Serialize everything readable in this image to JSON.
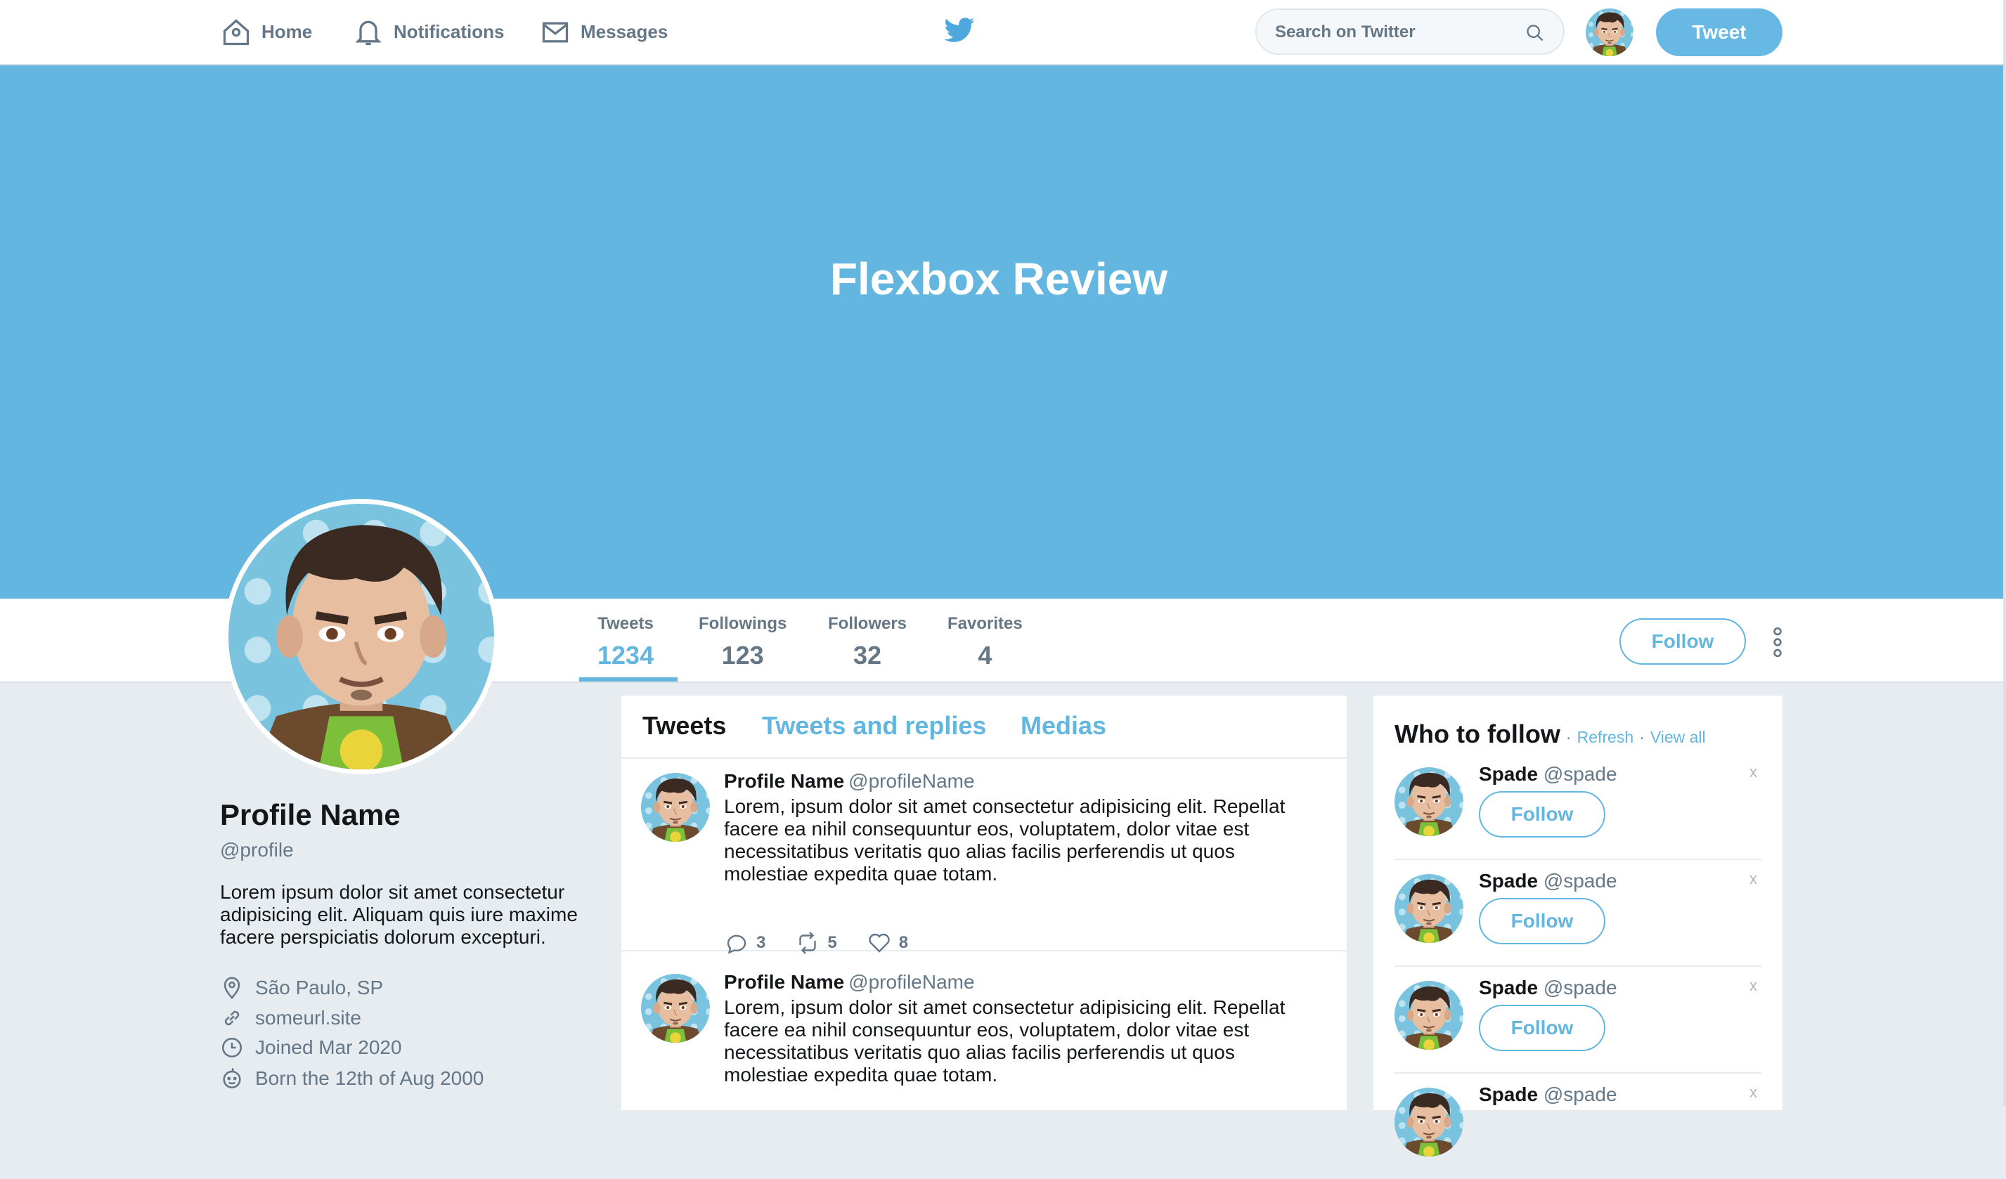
{
  "nav": {
    "home": "Home",
    "notifications": "Notifications",
    "messages": "Messages",
    "search_placeholder": "Search on Twitter",
    "tweet_button": "Tweet"
  },
  "banner": {
    "title": "Flexbox Review"
  },
  "stats": [
    {
      "label": "Tweets",
      "value": "1234"
    },
    {
      "label": "Followings",
      "value": "123"
    },
    {
      "label": "Followers",
      "value": "32"
    },
    {
      "label": "Favorites",
      "value": "4"
    }
  ],
  "profile": {
    "name": "Profile Name",
    "handle": "@profile",
    "bio": "Lorem ipsum dolor sit amet consectetur adipisicing elit. Aliquam quis iure maxime facere perspiciatis dolorum excepturi.",
    "location": "São Paulo, SP",
    "website": "someurl.site",
    "joined": "Joined Mar 2020",
    "born": "Born the 12th of Aug 2000",
    "follow_button": "Follow"
  },
  "tabs": [
    "Tweets",
    "Tweets and replies",
    "Medias"
  ],
  "tweets": [
    {
      "name": "Profile Name",
      "handle": "@profileName",
      "text": "Lorem, ipsum dolor sit amet consectetur adipisicing elit. Repellat facere ea nihil consequuntur eos, voluptatem, dolor vitae est necessitatibus veritatis quo alias facilis perferendis ut quos molestiae expedita quae totam.",
      "replies": "3",
      "retweets": "5",
      "likes": "8"
    },
    {
      "name": "Profile Name",
      "handle": "@profileName",
      "text": "Lorem, ipsum dolor sit amet consectetur adipisicing elit. Repellat facere ea nihil consequuntur eos, voluptatem, dolor vitae est necessitatibus veritatis quo alias facilis perferendis ut quos molestiae expedita quae totam."
    }
  ],
  "who_to_follow": {
    "title": "Who to follow",
    "refresh": "Refresh",
    "view_all": "View all",
    "dot": "·",
    "close": "x",
    "users": [
      {
        "name": "Spade",
        "handle": "@spade",
        "button": "Follow"
      },
      {
        "name": "Spade",
        "handle": "@spade",
        "button": "Follow"
      },
      {
        "name": "Spade",
        "handle": "@spade",
        "button": "Follow"
      },
      {
        "name": "Spade",
        "handle": "@spade"
      }
    ]
  },
  "colors": {
    "accent": "#63b6e0",
    "banner": "#63b6e0",
    "muted": "#657786",
    "background": "#e6ecf0"
  }
}
